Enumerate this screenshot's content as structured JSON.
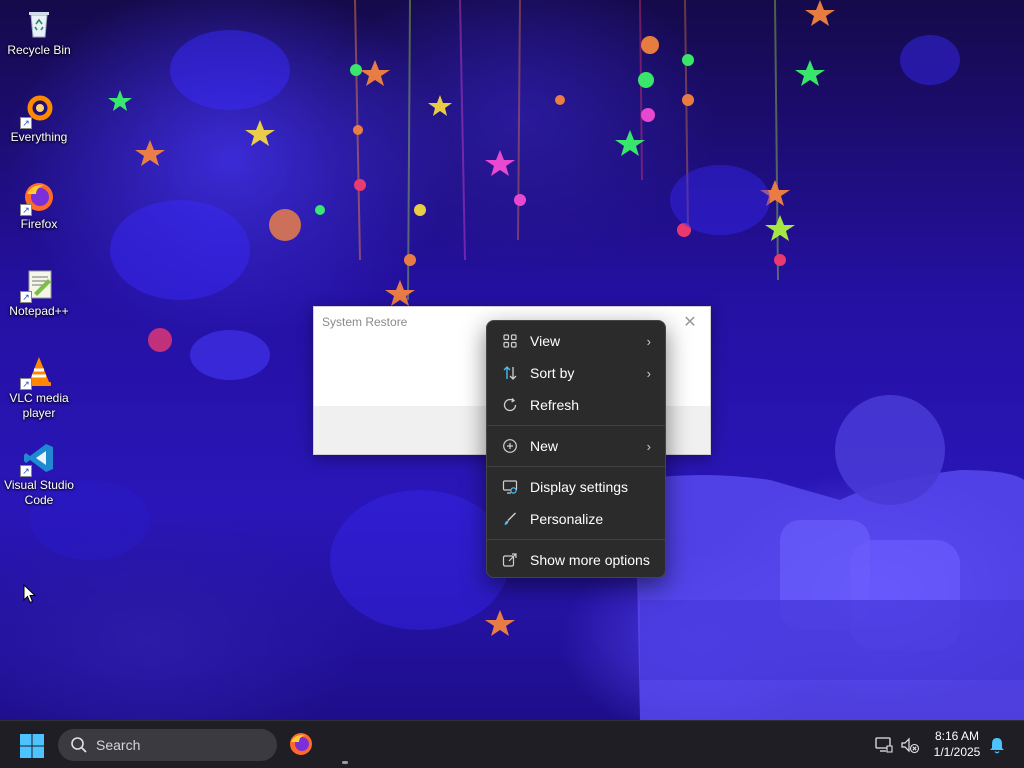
{
  "desktop": {
    "icons": [
      {
        "label": "Recycle Bin",
        "icon": "recycle-bin-icon"
      },
      {
        "label": "Everything",
        "icon": "everything-icon"
      },
      {
        "label": "Firefox",
        "icon": "firefox-icon"
      },
      {
        "label": "Notepad++",
        "icon": "notepad-plus-plus-icon"
      },
      {
        "label": "VLC media player",
        "icon": "vlc-icon"
      },
      {
        "label": "Visual Studio Code",
        "icon": "vscode-icon"
      }
    ]
  },
  "system_restore_window": {
    "title": "System Restore",
    "close_glyph": "✕"
  },
  "context_menu": {
    "items": [
      {
        "label": "View",
        "icon": "grid-view-icon",
        "has_submenu": true
      },
      {
        "label": "Sort by",
        "icon": "sort-icon",
        "has_submenu": true
      },
      {
        "label": "Refresh",
        "icon": "refresh-icon",
        "has_submenu": false
      },
      {
        "label": "New",
        "icon": "plus-circle-icon",
        "has_submenu": true
      },
      {
        "label": "Display settings",
        "icon": "display-settings-icon",
        "has_submenu": false
      },
      {
        "label": "Personalize",
        "icon": "brush-icon",
        "has_submenu": false
      },
      {
        "label": "Show more options",
        "icon": "more-options-icon",
        "has_submenu": false
      }
    ],
    "chevron": "›"
  },
  "taskbar": {
    "search_placeholder": "Search",
    "time": "8:16 AM",
    "date": "1/1/2025",
    "accent": "#4cc2ff"
  }
}
